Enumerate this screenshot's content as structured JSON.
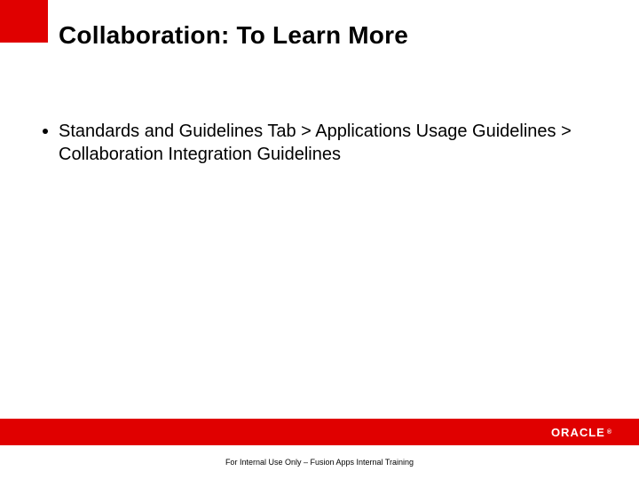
{
  "title": "Collaboration: To Learn More",
  "bullets": [
    "Standards and Guidelines Tab > Applications Usage Guidelines > Collaboration Integration Guidelines"
  ],
  "brand": "ORACLE",
  "brand_reg": "®",
  "footer": "For Internal Use Only – Fusion Apps Internal Training"
}
